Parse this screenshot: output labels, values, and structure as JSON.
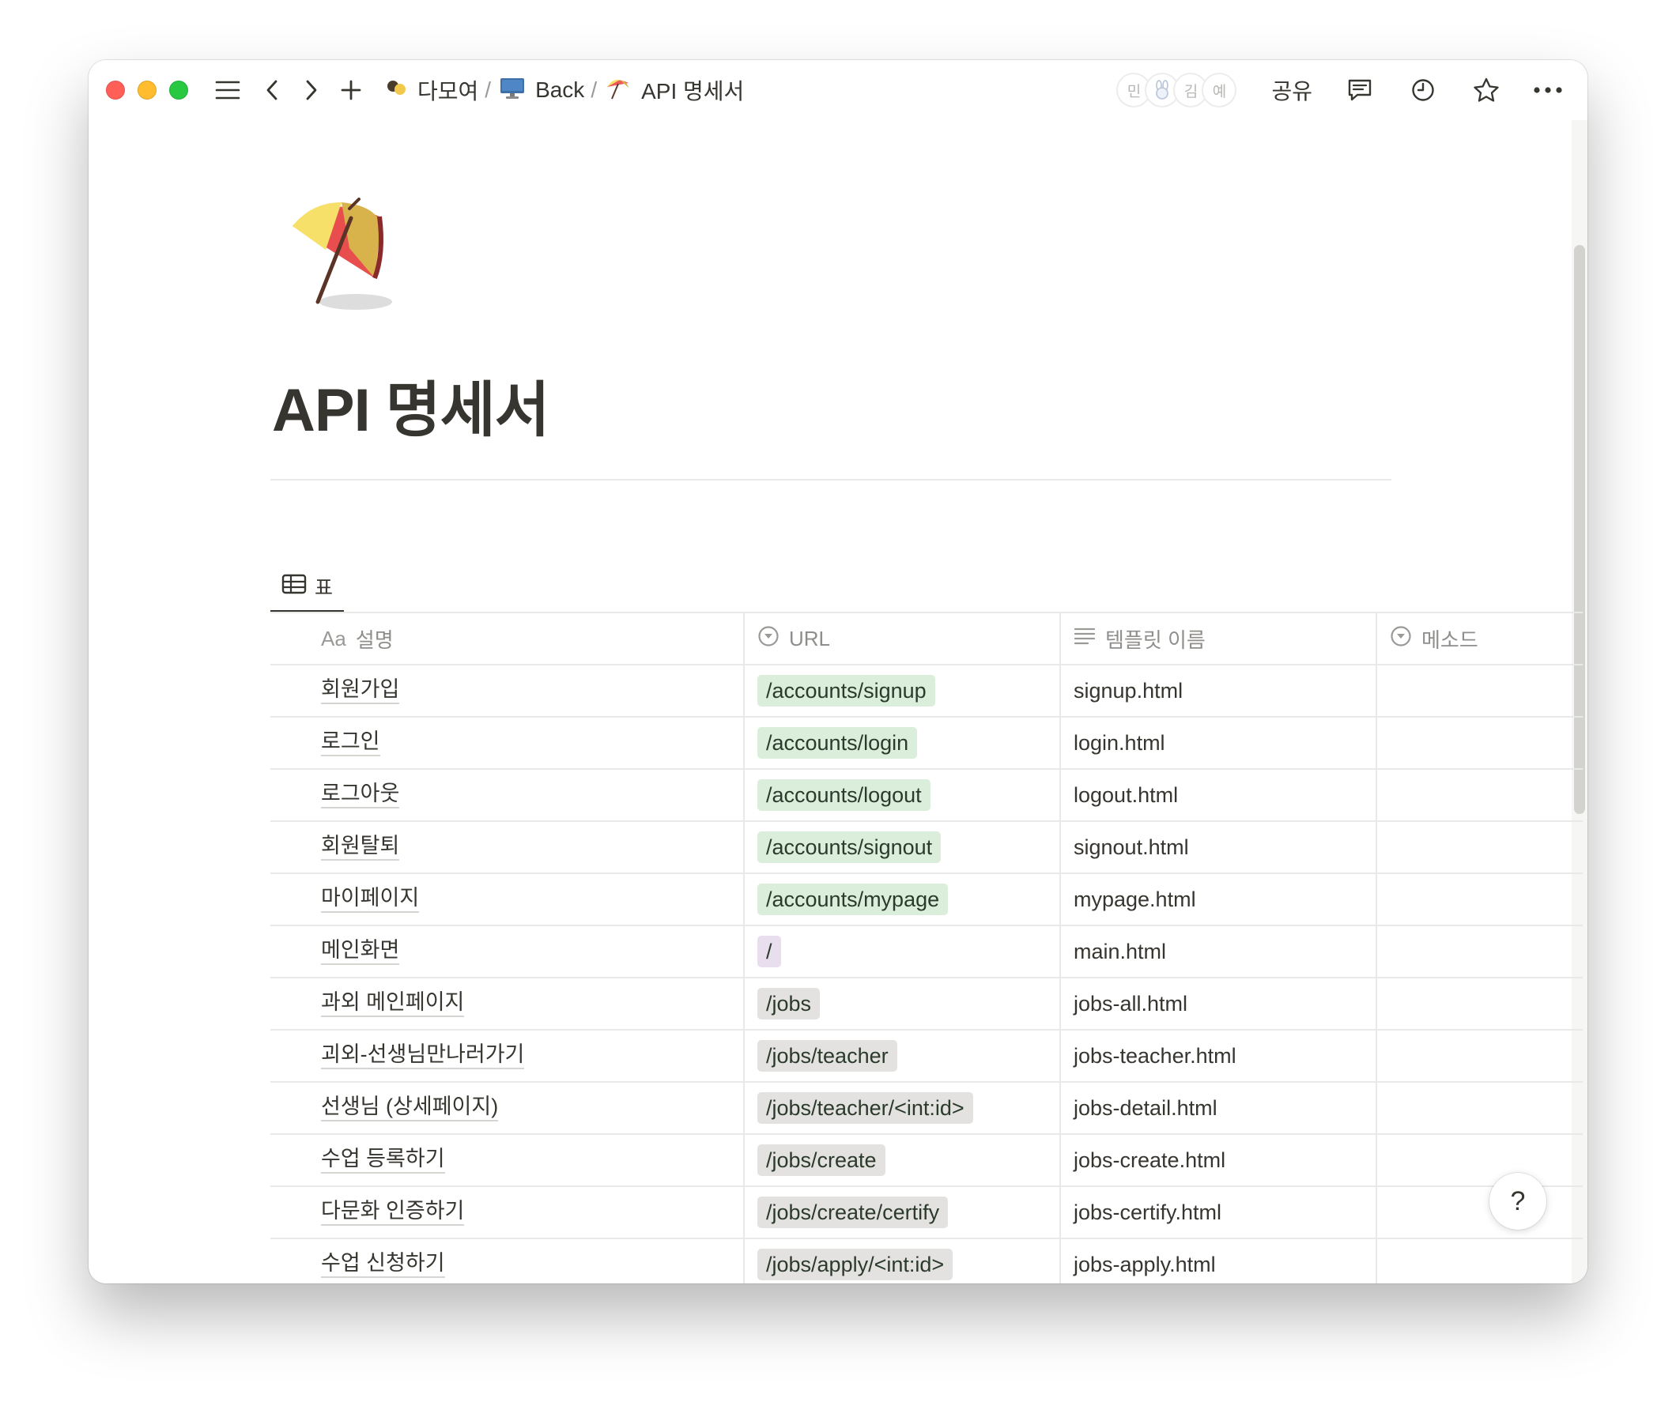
{
  "breadcrumb": [
    {
      "icon": "two-dots-icon",
      "label": "다모여"
    },
    {
      "icon": "desktop-computer-icon",
      "label": "Back"
    },
    {
      "icon": "beach-umbrella-icon",
      "label": "API 명세서"
    }
  ],
  "breadcrumb_separator": "/",
  "collaborators": [
    "민",
    "",
    "김",
    "예"
  ],
  "share_label": "공유",
  "page": {
    "title": "API 명세서",
    "icon": "beach-umbrella-icon"
  },
  "view_tab": {
    "label": "표",
    "icon": "table-icon"
  },
  "table": {
    "columns": [
      {
        "label": "설명",
        "prefix": "Aa"
      },
      {
        "label": "URL",
        "icon": "select-icon"
      },
      {
        "label": "템플릿 이름",
        "icon": "text-lines-icon"
      },
      {
        "label": "메소드",
        "icon": "select-icon"
      }
    ],
    "rows": [
      {
        "name": "회원가입",
        "url": "/accounts/signup",
        "url_color": "green",
        "template": "signup.html",
        "method": ""
      },
      {
        "name": "로그인",
        "url": "/accounts/login",
        "url_color": "green",
        "template": "login.html",
        "method": ""
      },
      {
        "name": "로그아웃",
        "url": "/accounts/logout",
        "url_color": "green",
        "template": "logout.html",
        "method": ""
      },
      {
        "name": "회원탈퇴",
        "url": "/accounts/signout",
        "url_color": "green",
        "template": "signout.html",
        "method": ""
      },
      {
        "name": "마이페이지",
        "url": "/accounts/mypage",
        "url_color": "green",
        "template": "mypage.html",
        "method": ""
      },
      {
        "name": "메인화면",
        "url": "/",
        "url_color": "purple",
        "template": "main.html",
        "method": ""
      },
      {
        "name": "과외 메인페이지",
        "url": "/jobs",
        "url_color": "gray",
        "template": "jobs-all.html",
        "method": ""
      },
      {
        "name": "괴외-선생님만나러가기",
        "url": "/jobs/teacher",
        "url_color": "gray",
        "template": "jobs-teacher.html",
        "method": ""
      },
      {
        "name": "선생님 (상세페이지)",
        "url": "/jobs/teacher/<int:id>",
        "url_color": "gray",
        "template": "jobs-detail.html",
        "method": ""
      },
      {
        "name": "수업 등록하기",
        "url": "/jobs/create",
        "url_color": "gray",
        "template": "jobs-create.html",
        "method": ""
      },
      {
        "name": "다문화 인증하기",
        "url": "/jobs/create/certify",
        "url_color": "gray",
        "template": "jobs-certify.html",
        "method": ""
      },
      {
        "name": "수업 신청하기",
        "url": "/jobs/apply/<int:id>",
        "url_color": "gray",
        "template": "jobs-apply.html",
        "method": ""
      }
    ]
  },
  "help_label": "?"
}
